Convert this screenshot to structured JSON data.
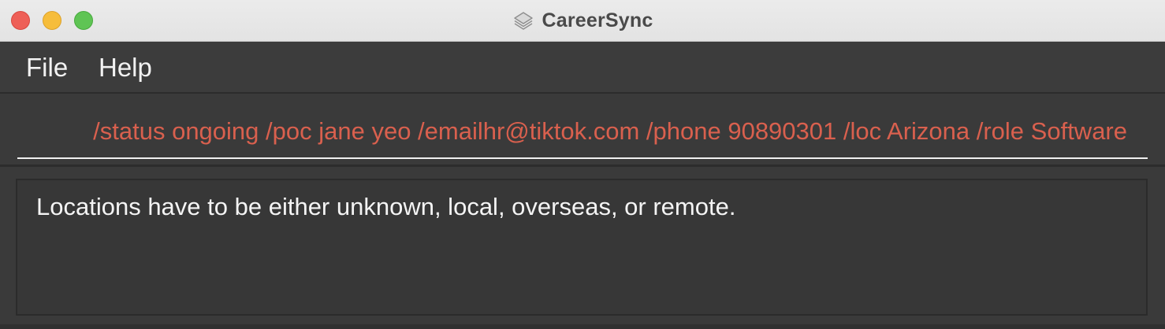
{
  "window": {
    "title": "CareerSync",
    "app_icon": "layers-stack-icon",
    "traffic_lights": {
      "close_color": "#ee5f57",
      "minimize_color": "#f6bd3b",
      "zoom_color": "#5fc454"
    }
  },
  "menubar": {
    "items": [
      {
        "label": "File"
      },
      {
        "label": "Help"
      }
    ]
  },
  "command_box": {
    "value": "/status ongoing /poc jane yeo /emailhr@tiktok.com /phone 90890301 /loc Arizona /role Software",
    "text_color": "#d9604e"
  },
  "result_display": {
    "message": "Locations have to be either unknown, local, overseas, or remote."
  },
  "colors": {
    "background": "#3a3a3a",
    "titlebar": "#e6e6e6",
    "error_text": "#d9604e",
    "text": "#f2f2f2"
  }
}
